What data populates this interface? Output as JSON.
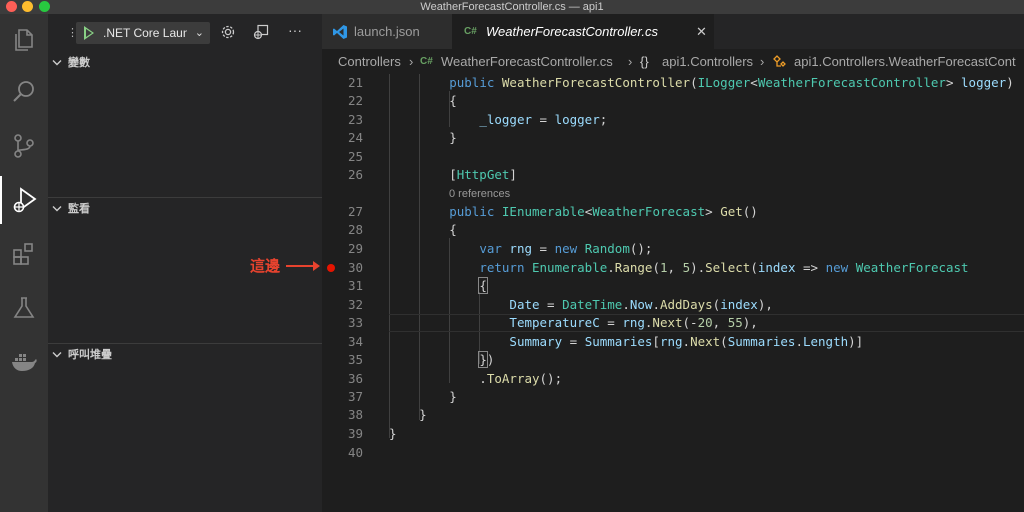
{
  "window": {
    "title": "WeatherForecastController.cs — api1"
  },
  "activity_bar": {
    "icons": [
      "explorer-icon",
      "search-icon",
      "source-control-icon",
      "run-debug-icon",
      "extensions-icon",
      "testing-icon",
      "docker-icon"
    ]
  },
  "sidebar": {
    "config_label": ".NET Core Launch",
    "sections": {
      "variables": "變數",
      "watch": "監看",
      "call_stack": "呼叫堆疊"
    }
  },
  "tabs": [
    {
      "label": "launch.json",
      "active": false
    },
    {
      "label": "WeatherForecastController.cs",
      "active": true,
      "badge": "C#"
    }
  ],
  "breadcrumb": {
    "items": [
      "Controllers",
      "WeatherForecastController.cs",
      "api1.Controllers",
      "api1.Controllers.WeatherForecastCont"
    ],
    "cs_badge": "C#",
    "ns_glyph": "{}"
  },
  "editor": {
    "line_numbers": [
      "21",
      "22",
      "23",
      "24",
      "25",
      "26",
      "27",
      "28",
      "29",
      "30",
      "31",
      "32",
      "33",
      "34",
      "35",
      "36",
      "37",
      "38",
      "39",
      "40"
    ],
    "codelens": "0 references",
    "breakpoint_line": "30"
  },
  "annotation": {
    "text": "這邊"
  },
  "colors": {
    "accent": "#007acc",
    "breakpoint": "#e51400",
    "annotation": "#e8432e",
    "csharp": "#68a063"
  }
}
